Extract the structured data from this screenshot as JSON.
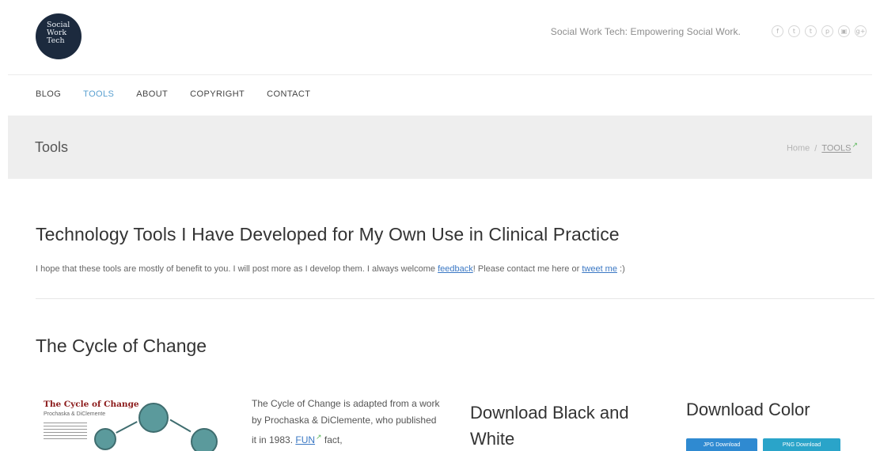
{
  "header": {
    "logo_lines": [
      "Social",
      "Work",
      "Tech"
    ],
    "tagline": "Social Work Tech: Empowering Social Work.",
    "social_icons": [
      {
        "name": "facebook-icon",
        "glyph": "f"
      },
      {
        "name": "twitter-icon",
        "glyph": "t"
      },
      {
        "name": "tumblr-icon",
        "glyph": "t"
      },
      {
        "name": "pinterest-icon",
        "glyph": "p"
      },
      {
        "name": "instagram-icon",
        "glyph": "▣"
      },
      {
        "name": "googleplus-icon",
        "glyph": "g+"
      }
    ]
  },
  "nav": {
    "items": [
      "BLOG",
      "TOOLS",
      "ABOUT",
      "COPYRIGHT",
      "CONTACT"
    ],
    "active": "TOOLS"
  },
  "titlebar": {
    "title": "Tools",
    "breadcrumb_home": "Home",
    "breadcrumb_sep": "/",
    "breadcrumb_current": "TOOLS"
  },
  "main": {
    "heading": "Technology Tools I Have Developed for My Own Use in Clinical Practice",
    "intro_part1": "I hope that these tools are mostly of benefit to you. I will post more as I develop them. I always welcome ",
    "intro_link1": "feedback",
    "intro_part2": "! Please contact me here or ",
    "intro_link2": "tweet me",
    "intro_part3": " :)"
  },
  "section": {
    "heading": "The Cycle of Change",
    "thumb_title": "The Cycle of Change",
    "thumb_subtitle": "Prochaska & DiClemente",
    "description_part1": "The Cycle of Change is adapted from a work by Prochaska & DiClemente, who published it in 1983. ",
    "description_link": "FUN",
    "description_part2": " fact,",
    "download_bw": "Download Black and White",
    "download_color": "Download Color",
    "btn_jpg": "JPG Download",
    "btn_png": "PNG Download"
  },
  "colors": {
    "accent": "#5aa0d0",
    "link": "#3b78c4",
    "logo_bg": "#1c2a3e",
    "btn_jpg": "#2f8ad1",
    "btn_png": "#2aa4c9"
  }
}
